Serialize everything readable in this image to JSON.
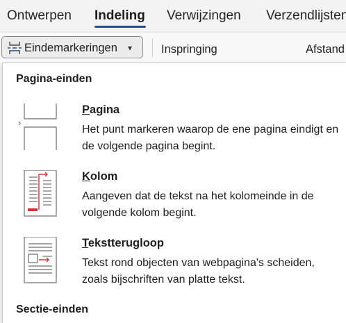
{
  "tabs": [
    {
      "label": "Ontwerpen",
      "active": false
    },
    {
      "label": "Indeling",
      "active": true
    },
    {
      "label": "Verwijzingen",
      "active": false
    },
    {
      "label": "Verzendlijsten",
      "active": false
    }
  ],
  "ribbon": {
    "breaks_button": {
      "label": "Eindemarkeringen",
      "icon": "page-break-icon"
    },
    "indent_label": "Inspringing",
    "spacing_label": "Afstand"
  },
  "menu": {
    "page_breaks_header": "Pagina-einden",
    "items": [
      {
        "title_key": "P",
        "title_rest": "agina",
        "description": "Het punt markeren waarop de ene pagina eindigt en de volgende pagina begint.",
        "icon": "page-break-thumbnail-icon"
      },
      {
        "title_key": "K",
        "title_rest": "olom",
        "description": "Aangeven dat de tekst na het kolomeinde in de volgende kolom begint.",
        "icon": "column-break-thumbnail-icon"
      },
      {
        "title_key": "T",
        "title_rest": "ekstterugloop",
        "description": "Tekst rond objecten van webpagina's scheiden, zoals bijschriften van platte tekst.",
        "icon": "text-wrapping-thumbnail-icon"
      }
    ],
    "section_breaks_header": "Sectie-einden"
  },
  "colors": {
    "accent": "#1f4e99",
    "break_red": "#d13438",
    "menu_bg": "#ffffff",
    "ribbon_bg": "#f3f3f3"
  }
}
